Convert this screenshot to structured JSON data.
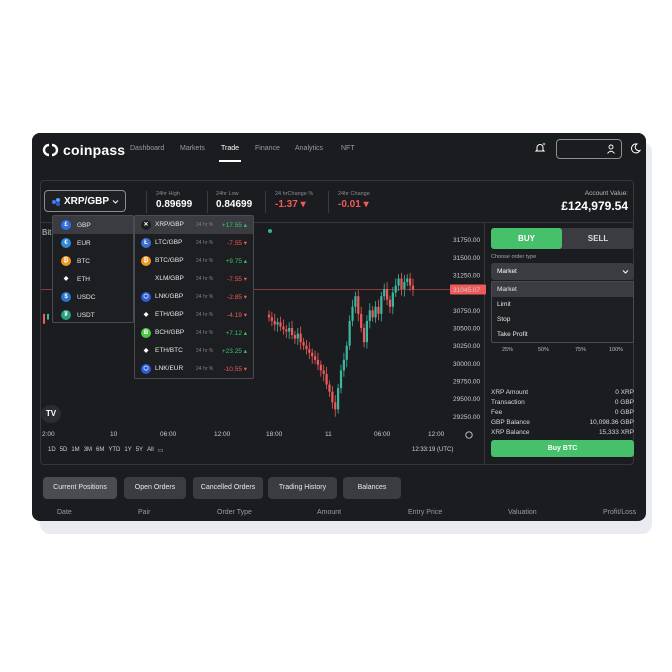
{
  "brand": {
    "name": "coinpass"
  },
  "nav": {
    "items": [
      "Dashboard",
      "Markets",
      "Trade",
      "Finance",
      "Analytics",
      "NFT"
    ],
    "active": "Trade"
  },
  "pair": {
    "label": "XRP/GBP",
    "icon": "xrp-icon"
  },
  "stats": [
    {
      "label": "24hr High",
      "value": "0.89699",
      "tone": "neutral"
    },
    {
      "label": "24hr Low",
      "value": "0.84699",
      "tone": "neutral"
    },
    {
      "label": "24 hrChange %",
      "value": "-1.37 ▾",
      "tone": "neg"
    },
    {
      "label": "24hr Change",
      "value": "-0.01 ▾",
      "tone": "neg"
    }
  ],
  "account": {
    "label": "Account Value:",
    "value": "£124,979.54"
  },
  "chart_title_fragment": "Bit",
  "price_axis": [
    "31750.00",
    "31500.00",
    "31250.00",
    "31045.07",
    "30750.00",
    "30500.00",
    "30250.00",
    "30000.00",
    "29750.00",
    "29500.00",
    "29250.00"
  ],
  "price_axis_current": "31045.07",
  "time_axis": [
    "2:00",
    "10",
    "06:00",
    "12:00",
    "18:00",
    "11",
    "06:00",
    "12:00"
  ],
  "timeframes": [
    "1D",
    "5D",
    "1M",
    "3M",
    "6M",
    "YTD",
    "1Y",
    "5Y",
    "All"
  ],
  "clock": "12:33:19 (UTC)",
  "tv_logo": "TV",
  "chart_data": {
    "type": "candlestick",
    "ylim": [
      29100,
      31900
    ],
    "candles_summary": "intraday BTC/GBP candles, dip to ~29300 near 18:00 then recovery to ~31200",
    "closes": [
      30650,
      30600,
      30550,
      30580,
      30520,
      30480,
      30450,
      30500,
      30400,
      30350,
      30420,
      30300,
      30250,
      30200,
      30150,
      30100,
      30050,
      29980,
      29900,
      29850,
      29700,
      29600,
      29450,
      29350,
      29650,
      29900,
      30050,
      30250,
      30600,
      30800,
      30950,
      30700,
      30500,
      30300,
      30600,
      30750,
      30650,
      30800,
      30700,
      30950,
      31050,
      30900,
      30800,
      31000,
      31100,
      31200,
      31050,
      31150,
      31200,
      31100,
      31045
    ]
  },
  "dropdown_currencies": [
    {
      "label": "GBP",
      "icon": "gbp-icon",
      "color": "#2f6fe0",
      "glyph": "£",
      "active": true
    },
    {
      "label": "EUR",
      "icon": "eur-icon",
      "color": "#2f8bd8",
      "glyph": "€",
      "active": false
    },
    {
      "label": "BTC",
      "icon": "btc-icon",
      "color": "#f2971a",
      "glyph": "₿",
      "active": false
    },
    {
      "label": "ETH",
      "icon": "eth-icon",
      "color": "#1d1e22",
      "glyph": "◆",
      "active": false
    },
    {
      "label": "USDC",
      "icon": "usdc-icon",
      "color": "#2775ca",
      "glyph": "$",
      "active": false
    },
    {
      "label": "USDT",
      "icon": "usdt-icon",
      "color": "#26a17b",
      "glyph": "₮",
      "active": false
    }
  ],
  "dropdown_pairs": [
    {
      "label": "XRP/GBP",
      "sub": "24 hr %",
      "change": "+17.55 ▴",
      "tone": "pos",
      "icon": "xrp-icon",
      "color": "#1d1e22",
      "glyph": "✕",
      "active": true
    },
    {
      "label": "LTC/GBP",
      "sub": "24 hr %",
      "change": "-7.55 ▾",
      "tone": "neg",
      "icon": "ltc-icon",
      "color": "#3b6fd6",
      "glyph": "Ł",
      "active": false
    },
    {
      "label": "BTC/GBP",
      "sub": "24 hr %",
      "change": "+9.75 ▴",
      "tone": "pos",
      "icon": "btc-icon",
      "color": "#f2971a",
      "glyph": "₿",
      "active": false
    },
    {
      "label": "XLM/GBP",
      "sub": "24 hr %",
      "change": "-7.55 ▾",
      "tone": "neg",
      "icon": "xlm-icon",
      "color": "#1d1e22",
      "glyph": "",
      "active": false
    },
    {
      "label": "LNK/GBP",
      "sub": "24 hr %",
      "change": "-2.85 ▾",
      "tone": "neg",
      "icon": "lnk-icon",
      "color": "#2a5ada",
      "glyph": "⬡",
      "active": false
    },
    {
      "label": "ETH/GBP",
      "sub": "24 hr %",
      "change": "-4.19 ▾",
      "tone": "neg",
      "icon": "eth-icon",
      "color": "#1d1e22",
      "glyph": "◆",
      "active": false
    },
    {
      "label": "BCH/GBP",
      "sub": "24 hr %",
      "change": "+7.12 ▴",
      "tone": "pos",
      "icon": "bch-icon",
      "color": "#4cc947",
      "glyph": "Ƀ",
      "active": false
    },
    {
      "label": "ETH/BTC",
      "sub": "24 hr %",
      "change": "+23.25 ▴",
      "tone": "pos",
      "icon": "eth-icon",
      "color": "#1d1e22",
      "glyph": "◆",
      "active": false
    },
    {
      "label": "LNK/EUR",
      "sub": "24 hr %",
      "change": "-10.55 ▾",
      "tone": "neg",
      "icon": "lnk-icon",
      "color": "#2a5ada",
      "glyph": "⬡",
      "active": false
    }
  ],
  "order": {
    "buy_label": "BUY",
    "sell_label": "SELL",
    "type_label": "Choose order type",
    "selected": "Market",
    "options": [
      "Market",
      "Limit",
      "Stop",
      "Take Profit"
    ],
    "percents": [
      "25%",
      "50%",
      "75%",
      "100%"
    ],
    "info": [
      {
        "k": "XRP Amount",
        "v": "0 XRP"
      },
      {
        "k": "Transaction",
        "v": "0 GBP"
      },
      {
        "k": "Fee",
        "v": "0 GBP"
      },
      {
        "k": "GBP Balance",
        "v": "10,098.36 GBP"
      },
      {
        "k": "XRP Balance",
        "v": "15,333 XRP"
      }
    ],
    "submit_label": "Buy BTC"
  },
  "bottom_tabs": [
    "Current Positions",
    "Open Orders",
    "Cancelled Orders",
    "Trading History",
    "Balances"
  ],
  "table_headers": [
    "Date",
    "Pair",
    "Order Type",
    "Amount",
    "Entry Price",
    "Valuation",
    "Profit/Loss"
  ],
  "colors": {
    "up": "#3ab8a0",
    "down": "#ef5a5a",
    "buy": "#46c06b",
    "bg": "#1b1c1f"
  }
}
